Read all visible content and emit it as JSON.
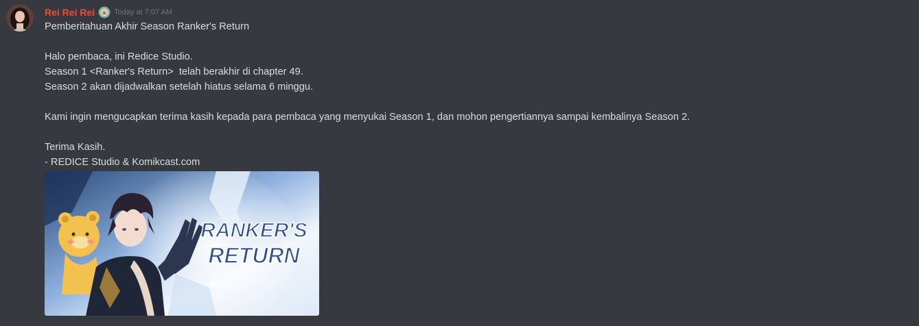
{
  "message": {
    "author": "Rei Rei Rei",
    "author_color": "#ef4d2d",
    "role_icon": "role-badge-icon",
    "timestamp": "Today at 7:07 AM",
    "lines": [
      "Pemberitahuan Akhir Season Ranker's Return",
      "",
      "Halo pembaca, ini Redice Studio.",
      "Season 1 <Ranker's Return>  telah berakhir di chapter 49.",
      "Season 2 akan dijadwalkan setelah hiatus selama 6 minggu.",
      "",
      "Kami ingin mengucapkan terima kasih kepada para pembaca yang menyukai Season 1, dan mohon pengertiannya sampai kembalinya Season 2.",
      "",
      "Terima Kasih.",
      "- REDICE Studio & Komikcast.com"
    ],
    "attachment": {
      "logo_text_line1": "RANKER'S",
      "logo_text_line2": "RETURN"
    }
  },
  "colors": {
    "background": "#36393f",
    "text": "#dcddde",
    "timestamp": "#72767d"
  }
}
